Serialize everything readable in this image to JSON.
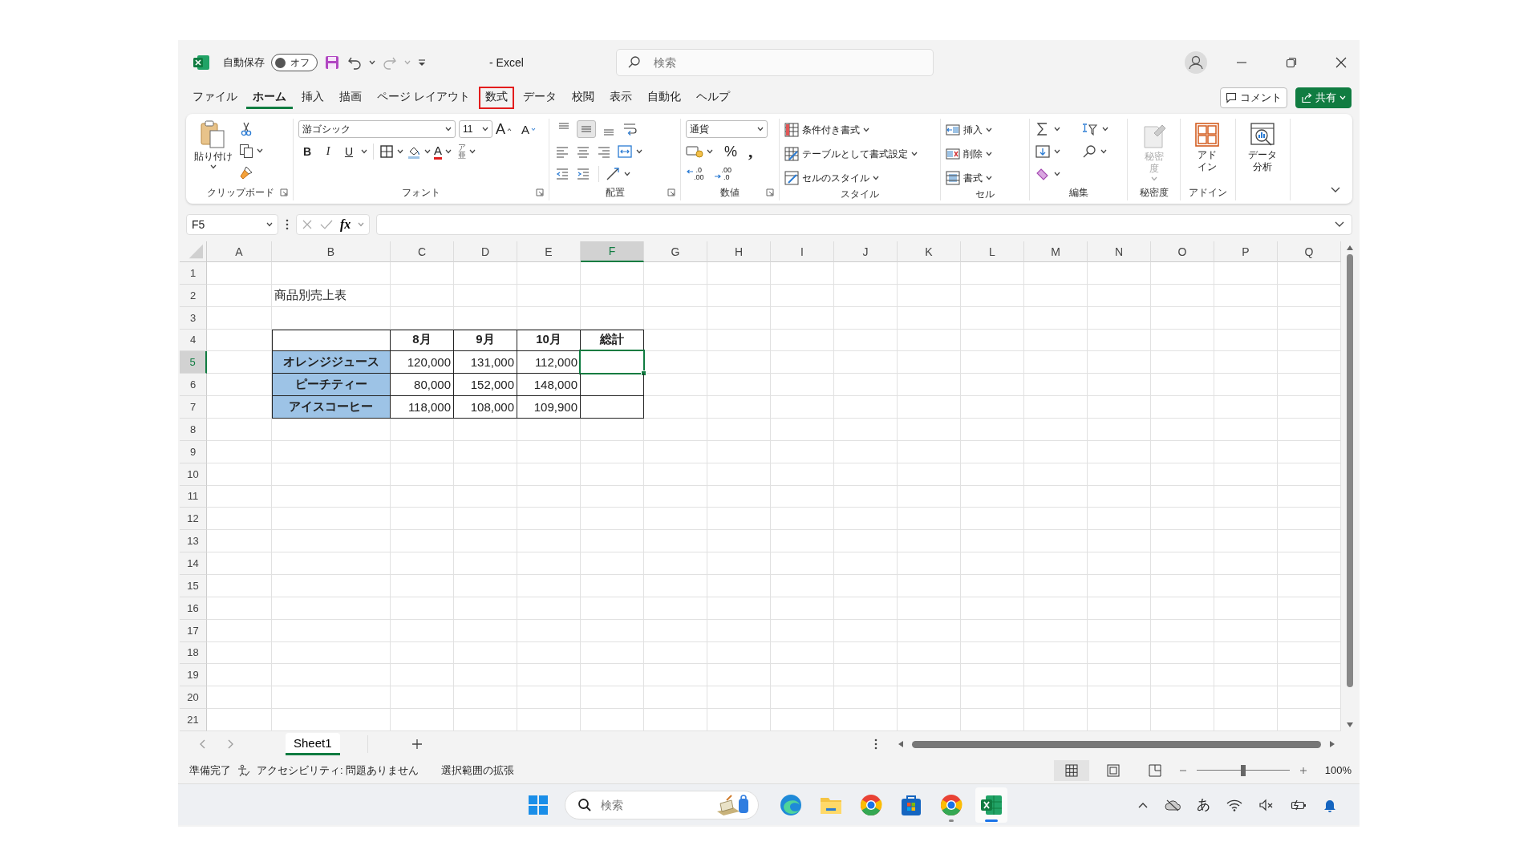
{
  "titlebar": {
    "autosave_label": "自動保存",
    "autosave": {
      "on": false,
      "text": "オフ"
    },
    "title": "- Excel",
    "search": {
      "placeholder": "検索"
    }
  },
  "menu_tabs": [
    {
      "label": "ファイル",
      "selected": false,
      "highlighted": false
    },
    {
      "label": "ホーム",
      "selected": true,
      "highlighted": false
    },
    {
      "label": "挿入",
      "selected": false,
      "highlighted": false
    },
    {
      "label": "描画",
      "selected": false,
      "highlighted": false
    },
    {
      "label": "ページ レイアウト",
      "selected": false,
      "highlighted": false
    },
    {
      "label": "数式",
      "selected": false,
      "highlighted": true
    },
    {
      "label": "データ",
      "selected": false,
      "highlighted": false
    },
    {
      "label": "校閲",
      "selected": false,
      "highlighted": false
    },
    {
      "label": "表示",
      "selected": false,
      "highlighted": false
    },
    {
      "label": "自動化",
      "selected": false,
      "highlighted": false
    },
    {
      "label": "ヘルプ",
      "selected": false,
      "highlighted": false
    }
  ],
  "comment_button": "コメント",
  "share_button": "共有",
  "ribbon": {
    "groups": [
      {
        "kind": "clipboard",
        "label": "クリップボード",
        "paste": "貼り付け"
      },
      {
        "kind": "font",
        "label": "フォント",
        "font_name": "游ゴシック",
        "font_size": "11",
        "grow": "A",
        "shrink": "A",
        "bold": "B",
        "italic": "I",
        "underline": "U",
        "font_color": "A",
        "phonetic": [
          "ア",
          "亜"
        ]
      },
      {
        "kind": "alignment",
        "label": "配置",
        "vertical": [
          {
            "kind": "top",
            "selected": false
          },
          {
            "kind": "middle",
            "selected": true
          },
          {
            "kind": "bottom",
            "selected": false
          }
        ]
      },
      {
        "kind": "number",
        "label": "数値",
        "format": "通貨",
        "percent": "%",
        "comma": ",",
        "decimals": [
          {
            "kind": "increase",
            "top": ".0",
            "bottom": ".00"
          },
          {
            "kind": "decrease",
            "top": ".00",
            "bottom": ".0"
          }
        ]
      },
      {
        "kind": "styles",
        "label": "スタイル",
        "items": [
          {
            "kind": "conditional",
            "label": "条件付き書式"
          },
          {
            "kind": "table",
            "label": "テーブルとして書式設定"
          },
          {
            "kind": "cell_styles",
            "label": "セルのスタイル"
          }
        ]
      },
      {
        "kind": "cells",
        "label": "セル",
        "items": [
          {
            "kind": "insert",
            "label": "挿入"
          },
          {
            "kind": "delete",
            "label": "削除"
          },
          {
            "kind": "format",
            "label": "書式"
          }
        ]
      },
      {
        "kind": "editing",
        "label": "編集"
      },
      {
        "kind": "sensitivity",
        "label": "秘密度",
        "button": "秘密度",
        "disabled": true
      },
      {
        "kind": "addins",
        "label": "アドイン",
        "button": "アドイン"
      },
      {
        "kind": "analysis",
        "button": "データ分析"
      }
    ]
  },
  "formula_bar": {
    "name_box": "F5",
    "fx": "fx"
  },
  "sheet": {
    "columns": [
      {
        "label": "A",
        "selected": false
      },
      {
        "label": "B",
        "selected": false
      },
      {
        "label": "C",
        "selected": false
      },
      {
        "label": "D",
        "selected": false
      },
      {
        "label": "E",
        "selected": false
      },
      {
        "label": "F",
        "selected": true
      },
      {
        "label": "G",
        "selected": false
      },
      {
        "label": "H",
        "selected": false
      },
      {
        "label": "I",
        "selected": false
      },
      {
        "label": "J",
        "selected": false
      },
      {
        "label": "K",
        "selected": false
      },
      {
        "label": "L",
        "selected": false
      },
      {
        "label": "M",
        "selected": false
      },
      {
        "label": "N",
        "selected": false
      },
      {
        "label": "O",
        "selected": false
      },
      {
        "label": "P",
        "selected": false
      },
      {
        "label": "Q",
        "selected": false
      }
    ],
    "rows": [
      {
        "label": "1",
        "selected": false
      },
      {
        "label": "2",
        "selected": false
      },
      {
        "label": "3",
        "selected": false
      },
      {
        "label": "4",
        "selected": false
      },
      {
        "label": "5",
        "selected": true
      },
      {
        "label": "6",
        "selected": false
      },
      {
        "label": "7",
        "selected": false
      },
      {
        "label": "8",
        "selected": false
      },
      {
        "label": "9",
        "selected": false
      },
      {
        "label": "10",
        "selected": false
      },
      {
        "label": "11",
        "selected": false
      },
      {
        "label": "12",
        "selected": false
      },
      {
        "label": "13",
        "selected": false
      },
      {
        "label": "14",
        "selected": false
      },
      {
        "label": "15",
        "selected": false
      },
      {
        "label": "16",
        "selected": false
      },
      {
        "label": "17",
        "selected": false
      },
      {
        "label": "18",
        "selected": false
      },
      {
        "label": "19",
        "selected": false
      },
      {
        "label": "20",
        "selected": false
      },
      {
        "label": "21",
        "selected": false
      }
    ],
    "title": "商品別売上表",
    "table": {
      "columns": [
        "8月",
        "9月",
        "10月",
        "総計"
      ],
      "rows": [
        {
          "product": "オレンジジュース",
          "values": [
            "120,000",
            "131,000",
            "112,000"
          ]
        },
        {
          "product": "ピーチティー",
          "values": [
            "80,000",
            "152,000",
            "148,000"
          ]
        },
        {
          "product": "アイスコーヒー",
          "values": [
            "118,000",
            "108,000",
            "109,900"
          ]
        }
      ]
    }
  },
  "sheet_tabs": [
    {
      "label": "Sheet1",
      "selected": true
    }
  ],
  "status_bar": {
    "ready": "準備完了",
    "accessibility": "アクセシビリティ: 問題ありません",
    "mode": "選択範囲の拡張",
    "view_buttons": [
      {
        "kind": "normal",
        "selected": true
      },
      {
        "kind": "page_layout",
        "selected": false
      },
      {
        "kind": "page_break",
        "selected": false
      }
    ],
    "zoom": {
      "level": 0.5,
      "text": "100%"
    }
  },
  "taskbar": {
    "search": {
      "placeholder": "検索"
    },
    "apps": [
      {
        "kind": "edge",
        "running": false,
        "active": false
      },
      {
        "kind": "folder",
        "running": false,
        "active": false
      },
      {
        "kind": "chrome",
        "running": false,
        "active": false
      },
      {
        "kind": "store",
        "running": false,
        "active": false
      },
      {
        "kind": "chrome",
        "running": true,
        "active": false
      },
      {
        "kind": "excel",
        "running": true,
        "active": true
      }
    ],
    "ime": "あ"
  }
}
